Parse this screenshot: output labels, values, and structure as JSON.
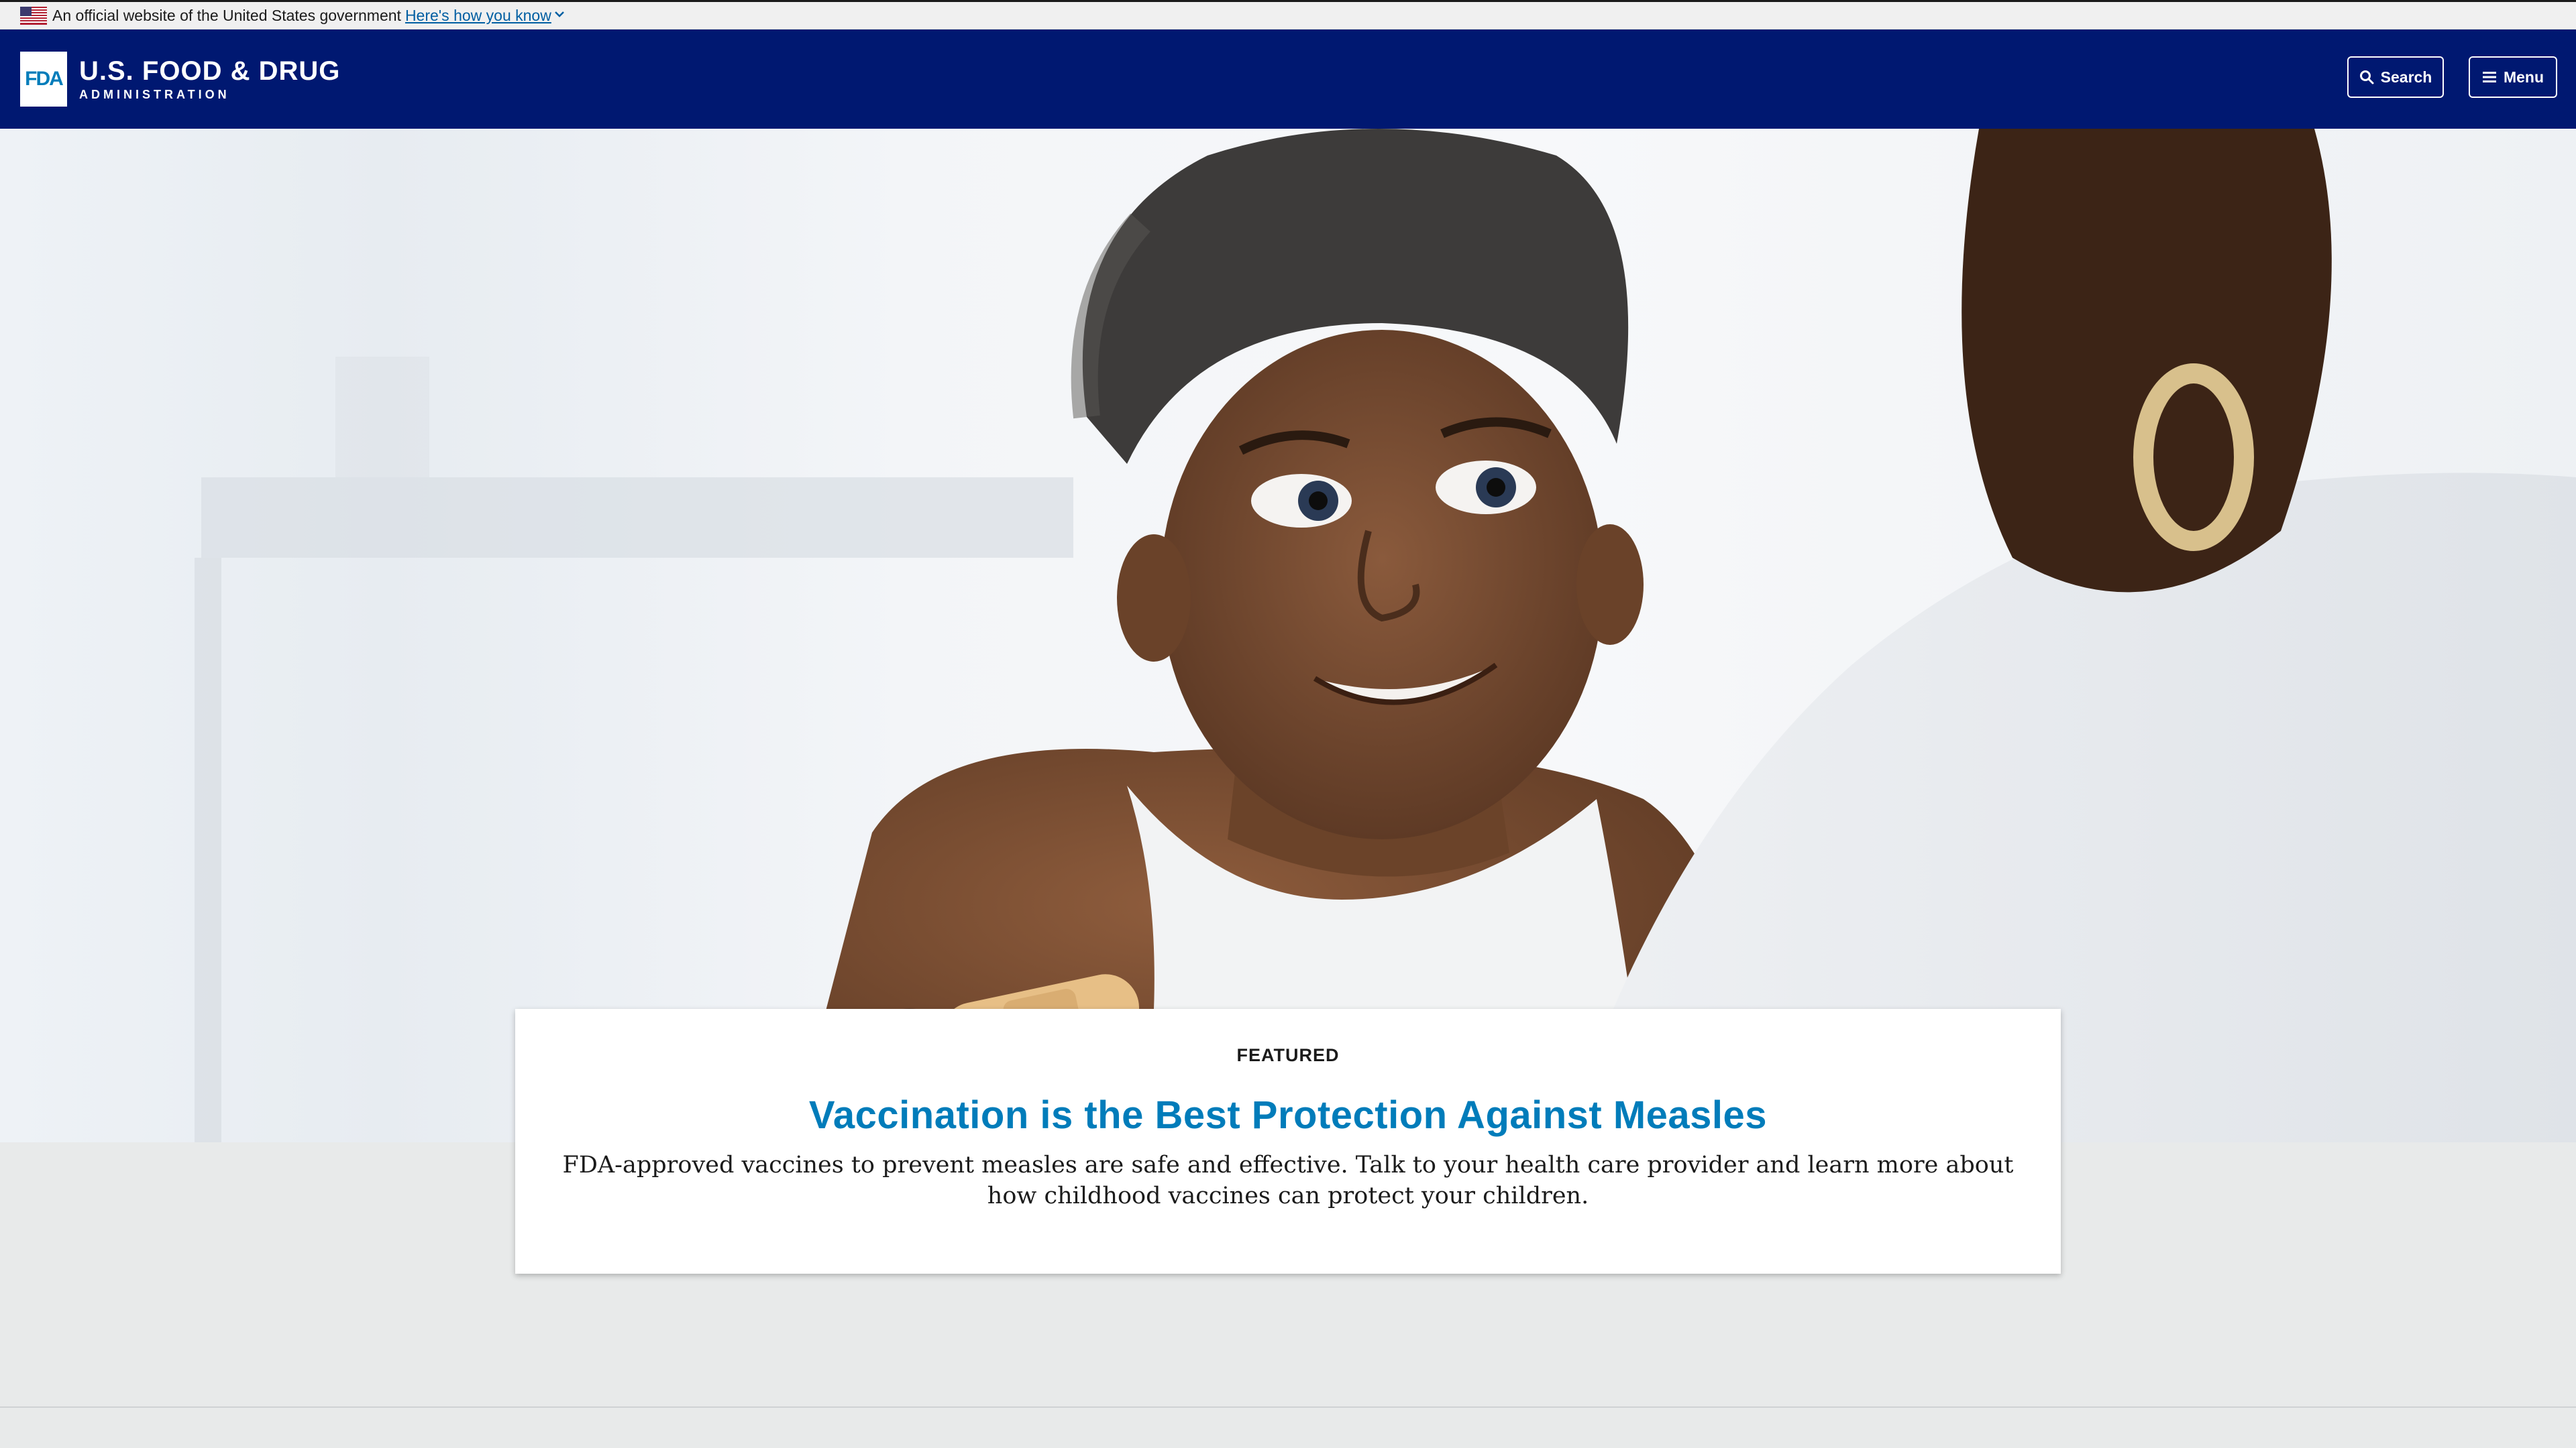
{
  "gov_banner": {
    "text": "An official website of the United States government",
    "link": "Here's how you know"
  },
  "header": {
    "logo_mark": "FDA",
    "logo_main": "U.S. FOOD & DRUG",
    "logo_sub": "ADMINISTRATION",
    "search_label": "Search",
    "menu_label": "Menu"
  },
  "featured": {
    "eyebrow": "FEATURED",
    "title": "Vaccination is the Best Protection Against Measles",
    "description": "FDA-approved vaccines to prevent measles are safe and effective. Talk to your health care provider and learn more about how childhood vaccines can protect your children."
  },
  "colors": {
    "header_bg": "#001871",
    "title_blue": "#007cba",
    "page_bg": "#e8eaea"
  }
}
